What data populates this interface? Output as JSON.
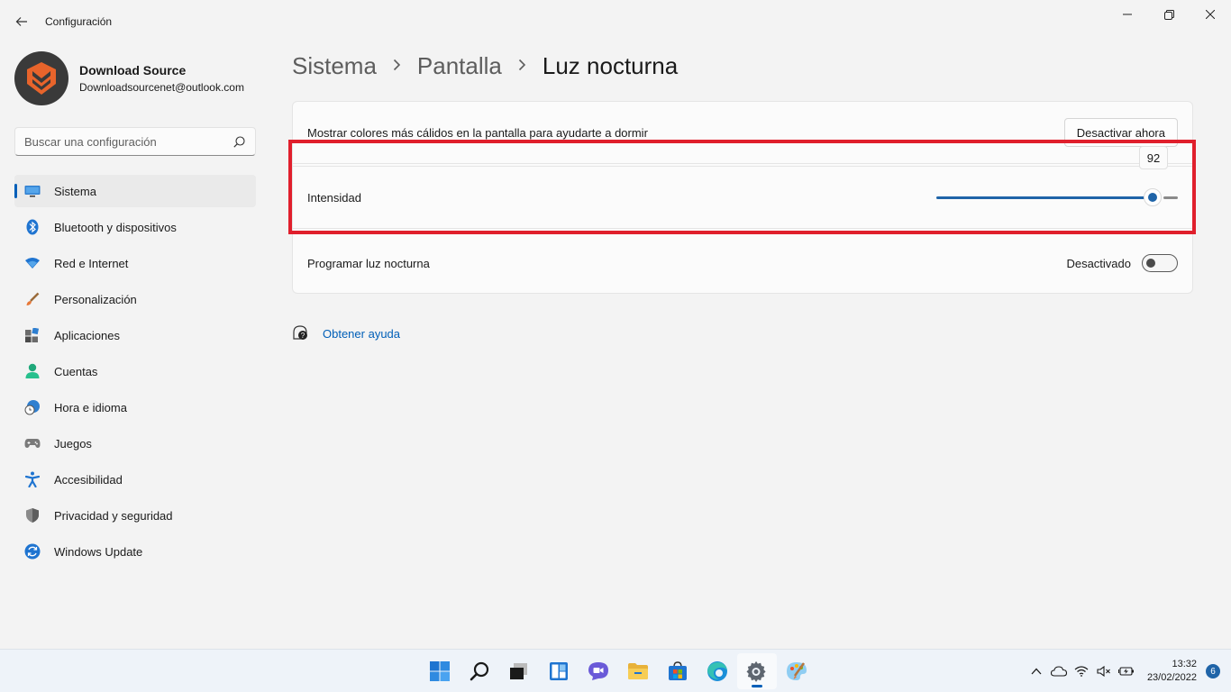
{
  "window": {
    "title": "Configuración",
    "controls": {
      "minimize": "—",
      "maximize": "❐",
      "close": "✕"
    }
  },
  "profile": {
    "name": "Download Source",
    "email": "Downloadsourcenet@outlook.com"
  },
  "search": {
    "placeholder": "Buscar una configuración"
  },
  "sidebar": {
    "items": [
      {
        "label": "Sistema",
        "icon": "monitor-icon",
        "active": true
      },
      {
        "label": "Bluetooth y dispositivos",
        "icon": "bluetooth-icon"
      },
      {
        "label": "Red e Internet",
        "icon": "wifi-icon"
      },
      {
        "label": "Personalización",
        "icon": "brush-icon"
      },
      {
        "label": "Aplicaciones",
        "icon": "apps-icon"
      },
      {
        "label": "Cuentas",
        "icon": "user-icon"
      },
      {
        "label": "Hora e idioma",
        "icon": "globe-clock-icon"
      },
      {
        "label": "Juegos",
        "icon": "gamepad-icon"
      },
      {
        "label": "Accesibilidad",
        "icon": "accessibility-icon"
      },
      {
        "label": "Privacidad y seguridad",
        "icon": "shield-icon"
      },
      {
        "label": "Windows Update",
        "icon": "update-icon"
      }
    ]
  },
  "breadcrumb": {
    "items": [
      "Sistema",
      "Pantalla",
      "Luz nocturna"
    ]
  },
  "settings": {
    "warm_colors": {
      "label": "Mostrar colores más cálidos en la pantalla para ayudarte a dormir",
      "button": "Desactivar ahora"
    },
    "intensity": {
      "label": "Intensidad",
      "value": 92,
      "min": 0,
      "max": 100
    },
    "schedule": {
      "label": "Programar luz nocturna",
      "toggle_state": "Desactivado",
      "on": false
    }
  },
  "help": {
    "label": "Obtener ayuda"
  },
  "taskbar": {
    "apps": [
      "start-icon",
      "search-icon",
      "task-view-icon",
      "widgets-icon",
      "chat-icon",
      "file-explorer-icon",
      "store-icon",
      "edge-icon",
      "settings-icon",
      "paint-icon"
    ],
    "active_app": "settings-icon",
    "time": "13:32",
    "date": "23/02/2022",
    "notifications": "6"
  },
  "colors": {
    "accent": "#005fb8",
    "highlight": "#e01f2c",
    "slider": "#1f64a8"
  }
}
